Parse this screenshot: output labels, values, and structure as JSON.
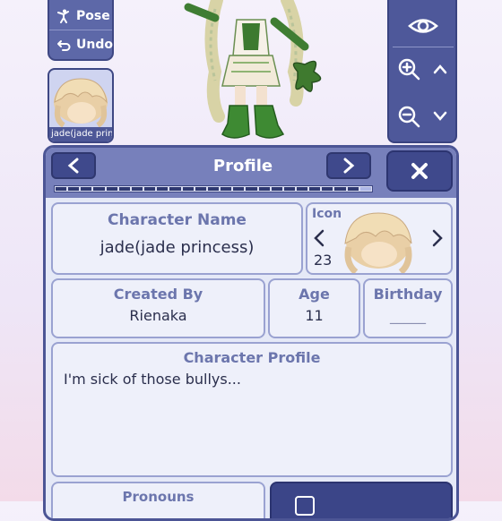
{
  "toolbar": {
    "pose_label": "Pose",
    "undo_label": "Undo"
  },
  "avatar": {
    "caption": "jade(jade prin"
  },
  "dialog": {
    "title": "Profile",
    "progress": 0.96,
    "character_name": {
      "label": "Character Name",
      "value": "jade(jade princess)"
    },
    "icon": {
      "label": "Icon",
      "number": "23"
    },
    "created_by": {
      "label": "Created By",
      "value": "Rienaka"
    },
    "age": {
      "label": "Age",
      "value": "11"
    },
    "birthday": {
      "label": "Birthday",
      "value": "_____"
    },
    "character_profile": {
      "label": "Character Profile",
      "value": "I'm sick of those bullys..."
    },
    "pronouns": {
      "label": "Pronouns"
    }
  },
  "colors": {
    "panel": "#4e589a",
    "header": "#7780bb",
    "label": "#6c76ad",
    "field_border": "#9aa2d1"
  },
  "icons": [
    "pose-icon",
    "undo-icon",
    "eye-icon",
    "zoom-in-icon",
    "zoom-out-icon",
    "chevron-up-icon",
    "chevron-down-icon",
    "chevron-left-icon",
    "chevron-right-icon",
    "close-icon"
  ]
}
